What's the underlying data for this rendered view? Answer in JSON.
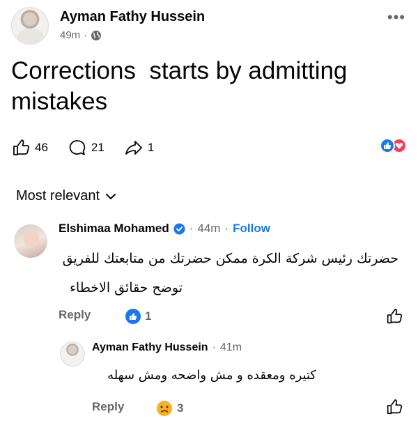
{
  "post": {
    "author": "Ayman Fathy Hussein",
    "time": "49m",
    "separator": "·",
    "text": "Corrections  starts by admitting mistakes",
    "likes": "46",
    "comments": "21",
    "shares": "1",
    "reaction_icons": [
      "like-icon",
      "love-icon"
    ]
  },
  "sort": {
    "label": "Most relevant"
  },
  "comments": [
    {
      "author": "Elshimaa Mohamed",
      "time": "44m",
      "follow_label": "Follow",
      "separator": "·",
      "line1": "حضرتك رئيس شركة الكرة ممكن حضرتك من متابعتك للفريق",
      "line2": "توضح حقائق الاخطاء",
      "reply_label": "Reply",
      "reaction_count": "1",
      "reaction_icon": "like-icon"
    },
    {
      "author": "Ayman Fathy Hussein",
      "time": "41m",
      "separator": "·",
      "line1": "كتيره ومعقده و مش واضحه ومش سهله",
      "reply_label": "Reply",
      "reaction_count": "3",
      "reaction_icon": "sad-icon"
    }
  ],
  "colors": {
    "accent": "#1877f2",
    "love": "#f33e58",
    "muted": "#65676b",
    "text": "#050505"
  }
}
